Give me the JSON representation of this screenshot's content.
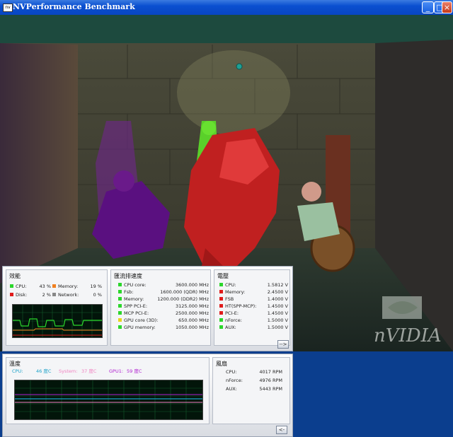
{
  "window": {
    "title": "NVPerformance Benchmark"
  },
  "scene": {
    "logo_text": "nVIDIA"
  },
  "perf": {
    "title": "效能",
    "cpu_label": "CPU:",
    "cpu_value": "43 %",
    "memory_label": "Memory:",
    "memory_value": "19 %",
    "disk_label": "Disk:",
    "disk_value": "2 %",
    "network_label": "Network:",
    "network_value": "0 %"
  },
  "clocks": {
    "title": "匯流排速度",
    "rows": [
      {
        "label": "CPU core:",
        "value": "3600.000 MHz",
        "color": "#2bd62b"
      },
      {
        "label": "Fsb:",
        "value": "1600.000 (QDR) MHz",
        "color": "#2bd62b"
      },
      {
        "label": "Memory:",
        "value": "1200.000 (DDR2) MHz",
        "color": "#2bd62b"
      },
      {
        "label": "SPP PCI-E:",
        "value": "3125.000 MHz",
        "color": "#2bd62b"
      },
      {
        "label": "MCP PCI-E:",
        "value": "2500.000 MHz",
        "color": "#2bd62b"
      },
      {
        "label": "GPU core (3D):",
        "value": "650.000 MHz",
        "color": "#e8d41a"
      },
      {
        "label": "GPU memory:",
        "value": "1050.000 MHz",
        "color": "#2bd62b"
      }
    ]
  },
  "voltage": {
    "title": "電壓",
    "rows": [
      {
        "label": "CPU:",
        "value": "1.5812 V",
        "color": "#2bd62b"
      },
      {
        "label": "Memory:",
        "value": "2.4500 V",
        "color": "#e01b1b"
      },
      {
        "label": "FSB",
        "value": "1.4000 V",
        "color": "#e01b1b"
      },
      {
        "label": "HT(SPP-MCP):",
        "value": "1.4500 V",
        "color": "#e01b1b"
      },
      {
        "label": "PCI-E:",
        "value": "1.4500 V",
        "color": "#e01b1b"
      },
      {
        "label": "nForce:",
        "value": "1.5000 V",
        "color": "#2bd62b"
      },
      {
        "label": "AUX:",
        "value": "1.5000 V",
        "color": "#2bd62b"
      }
    ]
  },
  "expand_button_label": "-->",
  "temperature": {
    "title": "溫度",
    "cpu_label": "CPU:",
    "cpu_value": "46 度C",
    "system_label": "System:",
    "system_value": "37 度C",
    "gpu_label": "GPU1:",
    "gpu_value": "59 度C"
  },
  "fans": {
    "title": "風扇",
    "rows": [
      {
        "label": "CPU:",
        "value": "4017 RPM"
      },
      {
        "label": "nForce:",
        "value": "4976 RPM"
      },
      {
        "label": "AUX:",
        "value": "5443 RPM"
      }
    ]
  },
  "collapse_button_label": "<-",
  "colors": {
    "cpu": "#2bd62b",
    "memory": "#f08020",
    "disk": "#e01b1b",
    "network": "#888888",
    "temp_cpu": "#1aa0c8",
    "temp_system": "#f080c0",
    "temp_gpu": "#b020d0"
  }
}
